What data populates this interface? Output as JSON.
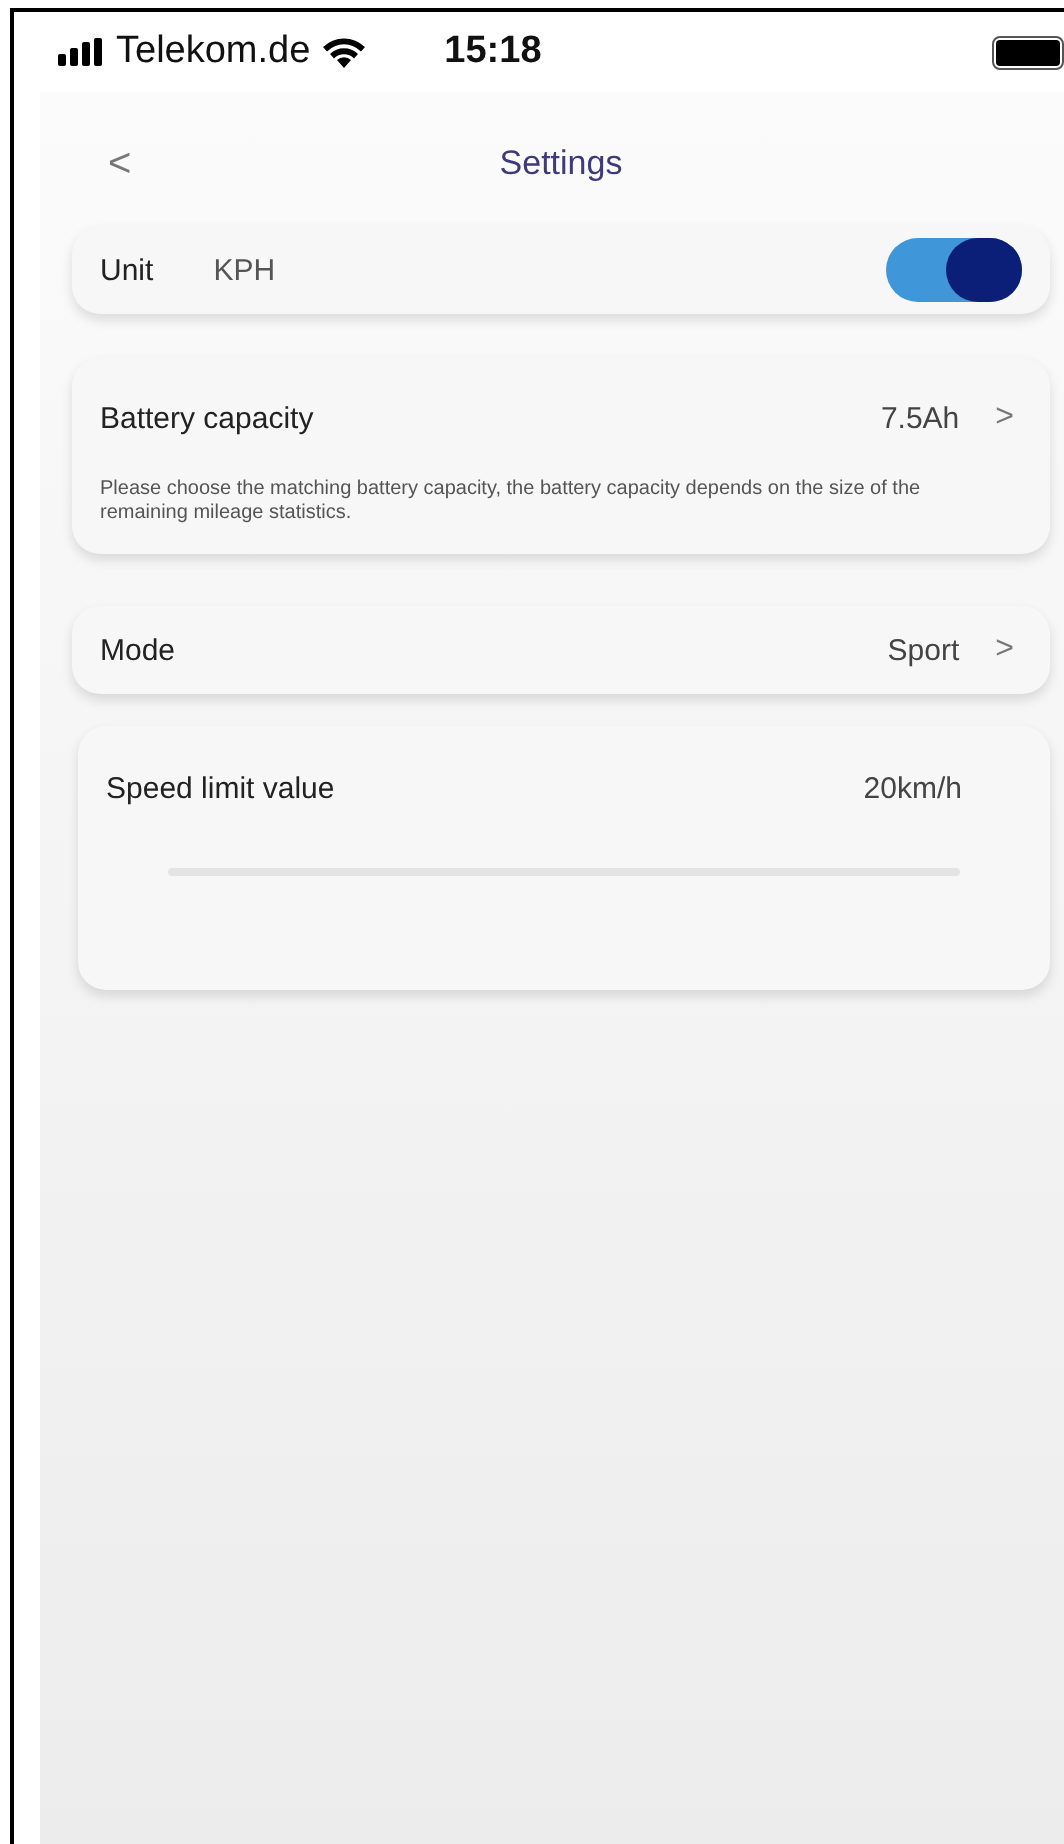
{
  "status_bar": {
    "carrier": "Telekom.de",
    "time": "15:18"
  },
  "nav": {
    "back": "<",
    "title": "Settings"
  },
  "unit": {
    "label": "Unit",
    "value": "KPH",
    "on": true
  },
  "battery": {
    "label": "Battery capacity",
    "value": "7.5Ah",
    "chevron": ">",
    "note": "Please choose the matching battery capacity, the battery capacity depends on the size of the remaining mileage statistics."
  },
  "mode": {
    "label": "Mode",
    "value": "Sport",
    "chevron": ">"
  },
  "speed_limit": {
    "label": "Speed limit value",
    "value": "20km/h"
  }
}
